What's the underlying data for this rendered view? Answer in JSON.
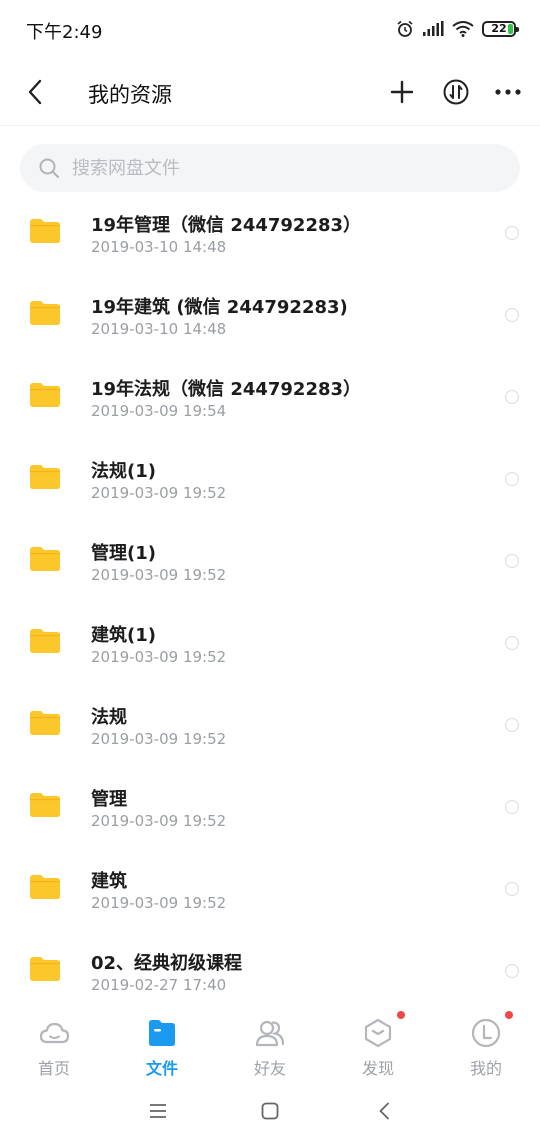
{
  "status_bar": {
    "time": "下午2:49",
    "battery": "22",
    "battery_color": "#36c24a"
  },
  "header": {
    "title": "我的资源",
    "back_icon": "chevron-left-icon",
    "add_icon": "plus-icon",
    "sort_icon": "sort-arrows-icon",
    "more_icon": "more-dots-icon"
  },
  "search": {
    "placeholder": "搜索网盘文件",
    "value": ""
  },
  "files": [
    {
      "name": "19年管理（微信 244792283）",
      "date": "2019-03-10  14:48"
    },
    {
      "name": "19年建筑 (微信 244792283)",
      "date": "2019-03-10  14:48"
    },
    {
      "name": "19年法规（微信 244792283）",
      "date": "2019-03-09  19:54"
    },
    {
      "name": "法规(1)",
      "date": "2019-03-09  19:52"
    },
    {
      "name": "管理(1)",
      "date": "2019-03-09  19:52"
    },
    {
      "name": "建筑(1)",
      "date": "2019-03-09  19:52"
    },
    {
      "name": "法规",
      "date": "2019-03-09  19:52"
    },
    {
      "name": "管理",
      "date": "2019-03-09  19:52"
    },
    {
      "name": "建筑",
      "date": "2019-03-09  19:52"
    },
    {
      "name": "02、经典初级课程",
      "date": "2019-02-27  17:40"
    }
  ],
  "bottom_nav": [
    {
      "label": "首页",
      "icon": "cloud-icon",
      "active": false,
      "badge": false
    },
    {
      "label": "文件",
      "icon": "folder-icon",
      "active": true,
      "badge": false
    },
    {
      "label": "好友",
      "icon": "friends-icon",
      "active": false,
      "badge": false
    },
    {
      "label": "发现",
      "icon": "discover-icon",
      "active": false,
      "badge": true
    },
    {
      "label": "我的",
      "icon": "profile-icon",
      "active": false,
      "badge": true
    }
  ],
  "colors": {
    "accent": "#1b9bf0",
    "folder": "#fcc72a",
    "badge": "#f04848"
  }
}
